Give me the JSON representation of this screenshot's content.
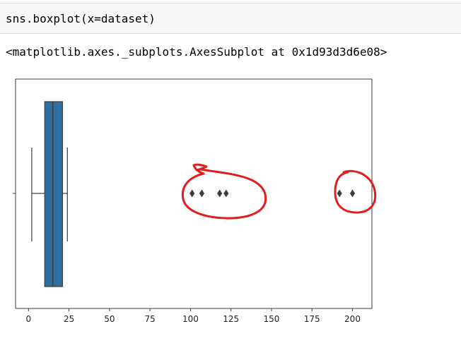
{
  "input_cell": {
    "code": "sns.boxplot(x=dataset)"
  },
  "output": {
    "repr": "<matplotlib.axes._subplots.AxesSubplot at 0x1d93d3d6e08>"
  },
  "colors": {
    "box_fill": "#2f6f9f",
    "box_edge": "#3d3d3d",
    "whisker": "#3d3d3d",
    "flier": "#3d3d3d",
    "annotation": "#e11d1d",
    "cell_bg": "#f7f7f7"
  },
  "chart_data": {
    "type": "boxplot",
    "orientation": "horizontal",
    "title": "",
    "xlabel": "",
    "ylabel": "",
    "xlim": [
      -8,
      212
    ],
    "xticks": [
      0,
      25,
      50,
      75,
      100,
      125,
      150,
      175,
      200
    ],
    "xtick_labels": [
      "0",
      "25",
      "50",
      "75",
      "100",
      "125",
      "150",
      "175",
      "200"
    ],
    "grid": false,
    "box": {
      "whisker_low": 2,
      "q1": 10,
      "median": 15,
      "q3": 21,
      "whisker_high": 24
    },
    "outliers": [
      101,
      107,
      118,
      122,
      192,
      200
    ],
    "annotations": [
      {
        "shape": "freehand-circle",
        "encloses_outliers": [
          101,
          107,
          118,
          122
        ]
      },
      {
        "shape": "freehand-circle",
        "encloses_outliers": [
          192,
          200
        ]
      }
    ]
  }
}
